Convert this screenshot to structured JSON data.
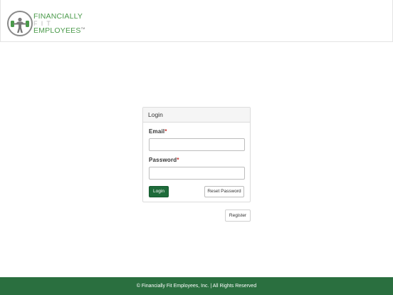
{
  "header": {
    "logo": {
      "line1": "FINANCIALLY",
      "line2": "FIT",
      "line3": "EMPLOYEES",
      "trademark": "TM",
      "icon": "weightlifter-icon",
      "brand_green": "#4a9a4a"
    }
  },
  "login_panel": {
    "title": "Login",
    "email": {
      "label": "Email",
      "required_mark": "*",
      "value": "",
      "placeholder": ""
    },
    "password": {
      "label": "Password",
      "required_mark": "*",
      "value": "",
      "placeholder": ""
    },
    "login_button": "Login",
    "reset_button": "Reset Password"
  },
  "register_button": "Register",
  "footer": {
    "text": "© Financially Fit Employees, Inc. | All Rights Reserved",
    "color": "#2a6f3f"
  },
  "colors": {
    "primary_button": "#1e6b3a",
    "required": "#c9302c"
  }
}
